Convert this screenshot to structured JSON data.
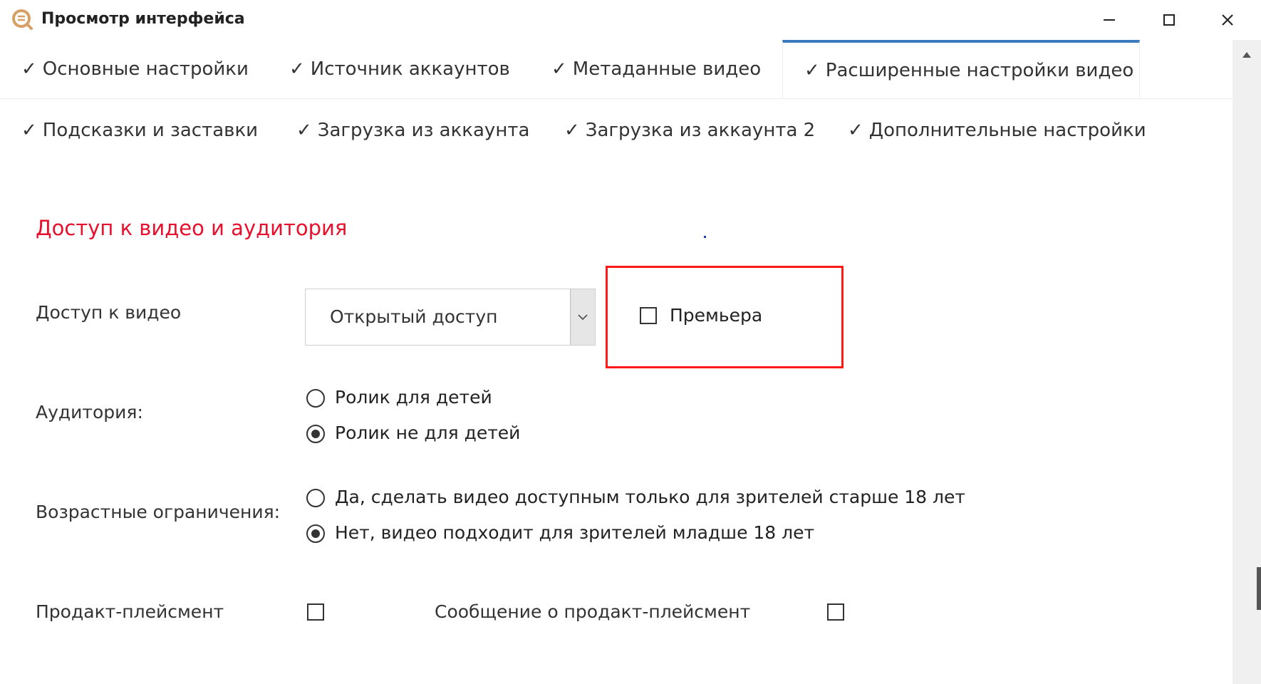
{
  "window": {
    "title": "Просмотр интерфейса",
    "app_icon": "app-logo-icon",
    "controls": [
      "minimize-icon",
      "maximize-icon",
      "close-icon"
    ]
  },
  "tabs": {
    "row1": [
      {
        "label": "Основные настройки",
        "checked": true,
        "active": false
      },
      {
        "label": "Источник аккаунтов",
        "checked": true,
        "active": false
      },
      {
        "label": "Метаданные видео",
        "checked": true,
        "active": false
      },
      {
        "label": "Расширенные настройки видео",
        "checked": true,
        "active": true
      }
    ],
    "row2": [
      {
        "label": "Подсказки и заставки",
        "checked": true
      },
      {
        "label": "Загрузка из аккаунта",
        "checked": true
      },
      {
        "label": "Загрузка из аккаунта 2",
        "checked": true
      },
      {
        "label": "Дополнительные настройки",
        "checked": true
      }
    ],
    "check_mark": "✓"
  },
  "section": {
    "title": "Доступ к видео и аудитория"
  },
  "video_access": {
    "label": "Доступ к видео",
    "selected": "Открытый доступ",
    "premiere_label": "Премьера",
    "premiere_checked": false
  },
  "audience": {
    "label": "Аудитория:",
    "options": [
      {
        "label": "Ролик для детей",
        "selected": false
      },
      {
        "label": "Ролик не для детей",
        "selected": true
      }
    ]
  },
  "age_restriction": {
    "label": "Возрастные ограничения:",
    "options": [
      {
        "label": "Да, сделать видео доступным только для зрителей старше 18 лет",
        "selected": false
      },
      {
        "label": "Нет, видео подходит для зрителей младше 18 лет",
        "selected": true
      }
    ]
  },
  "product_placement": {
    "label": "Продакт-плейсмент",
    "checked": false,
    "message_label": "Сообщение о продакт-плейсмент",
    "message_checked": false
  },
  "colors": {
    "accent": "#3a7bbf",
    "section_title": "#e8112d",
    "highlight": "#ff1a1a",
    "app_icon": "#d9a066"
  }
}
